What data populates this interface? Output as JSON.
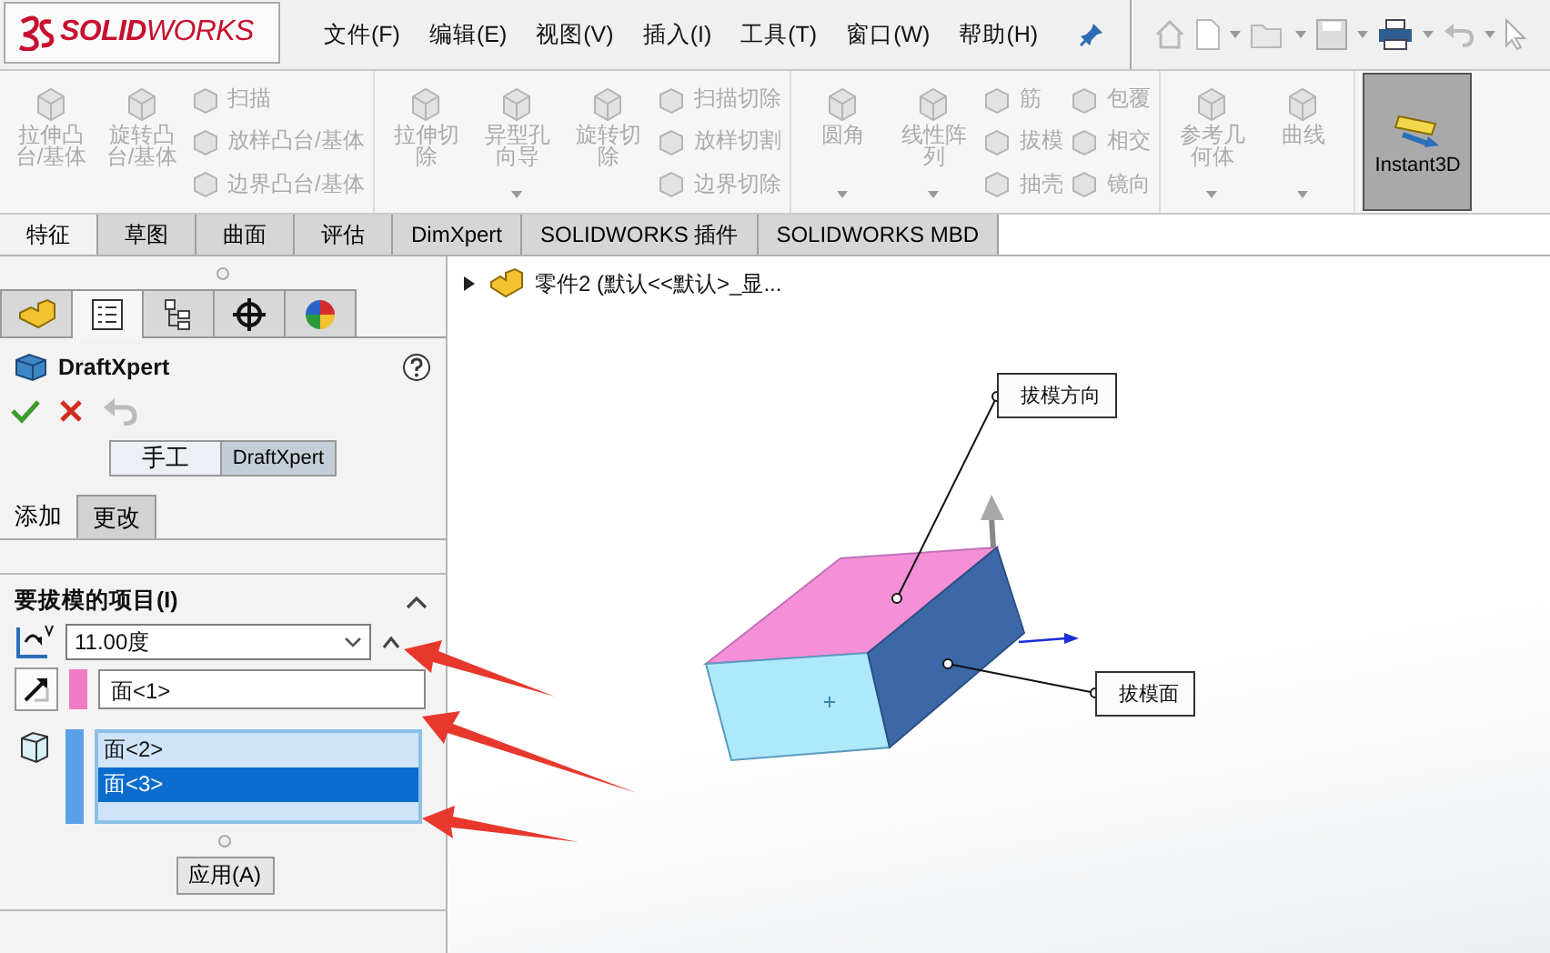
{
  "app": {
    "logo": "**SOLID**WORKS"
  },
  "menu": [
    "文件(F)",
    "编辑(E)",
    "视图(V)",
    "插入(I)",
    "工具(T)",
    "窗口(W)",
    "帮助(H)"
  ],
  "ribbon": {
    "groups": [
      {
        "items": [
          {
            "kind": "large",
            "label": "拉伸凸台/基体",
            "disabled": true,
            "dropdown": false
          },
          {
            "kind": "large",
            "label": "旋转凸台/基体",
            "disabled": true,
            "dropdown": false
          },
          {
            "kind": "small",
            "label": "扫描",
            "disabled": true
          },
          {
            "kind": "small",
            "label": "放样凸台/基体",
            "disabled": true
          },
          {
            "kind": "small",
            "label": "边界凸台/基体",
            "disabled": true
          }
        ]
      },
      {
        "items": [
          {
            "kind": "large",
            "label": "拉伸切除",
            "disabled": true,
            "dropdown": false
          },
          {
            "kind": "large",
            "label": "异型孔向导",
            "disabled": true,
            "dropdown": true
          },
          {
            "kind": "large",
            "label": "旋转切除",
            "disabled": true,
            "dropdown": false
          },
          {
            "kind": "small",
            "label": "扫描切除",
            "disabled": true
          },
          {
            "kind": "small",
            "label": "放样切割",
            "disabled": true
          },
          {
            "kind": "small",
            "label": "边界切除",
            "disabled": true
          }
        ]
      },
      {
        "items": [
          {
            "kind": "large",
            "label": "圆角",
            "disabled": true,
            "dropdown": true
          },
          {
            "kind": "large",
            "label": "线性阵列",
            "disabled": true,
            "dropdown": true
          },
          {
            "kind": "small",
            "label": "筋",
            "disabled": true
          },
          {
            "kind": "small",
            "label": "拔模",
            "disabled": true
          },
          {
            "kind": "small",
            "label": "抽壳",
            "disabled": true
          },
          {
            "kind": "small",
            "label": "包覆",
            "disabled": true
          },
          {
            "kind": "small",
            "label": "相交",
            "disabled": true
          },
          {
            "kind": "small",
            "label": "镜向",
            "disabled": true
          }
        ]
      },
      {
        "items": [
          {
            "kind": "large",
            "label": "参考几何体",
            "disabled": true,
            "dropdown": true
          },
          {
            "kind": "large",
            "label": "曲线",
            "disabled": true,
            "dropdown": true
          }
        ]
      }
    ],
    "instant3d": {
      "label": "Instant3D",
      "selected": true
    }
  },
  "command_tabs": [
    {
      "label": "特征",
      "selected": true
    },
    {
      "label": "草图",
      "selected": false
    },
    {
      "label": "曲面",
      "selected": false
    },
    {
      "label": "评估",
      "selected": false
    },
    {
      "label": "DimXpert",
      "selected": false
    },
    {
      "label": "SOLIDWORKS 插件",
      "selected": false
    },
    {
      "label": "SOLIDWORKS MBD",
      "selected": false
    }
  ],
  "manager_tabs": [
    {
      "selected": false
    },
    {
      "selected": true
    },
    {
      "selected": false
    },
    {
      "selected": false
    },
    {
      "selected": false
    }
  ],
  "property_manager": {
    "title": "DraftXpert",
    "mode_buttons": [
      {
        "label": "手工",
        "selected": false
      },
      {
        "label": "DraftXpert",
        "selected": true
      }
    ],
    "tabs": [
      {
        "label": "添加",
        "selected": true
      },
      {
        "label": "更改",
        "selected": false
      }
    ],
    "section": {
      "title": "要拔模的项目(I)",
      "expanded": true,
      "angle": "11.00度",
      "neutral_plane": {
        "value": "面<1>",
        "color": "#f07cc4"
      },
      "faces": {
        "color": "#5aa2e8",
        "items": [
          {
            "label": "面<2>",
            "selected": false
          },
          {
            "label": "面<3>",
            "selected": true
          }
        ]
      },
      "apply": "应用(A)"
    }
  },
  "viewport": {
    "tree_item": {
      "label": "零件2  (默认<<默认>_显...",
      "expanded": false
    },
    "callouts": [
      {
        "label": "拔模方向"
      },
      {
        "label": "拔模面"
      }
    ]
  }
}
